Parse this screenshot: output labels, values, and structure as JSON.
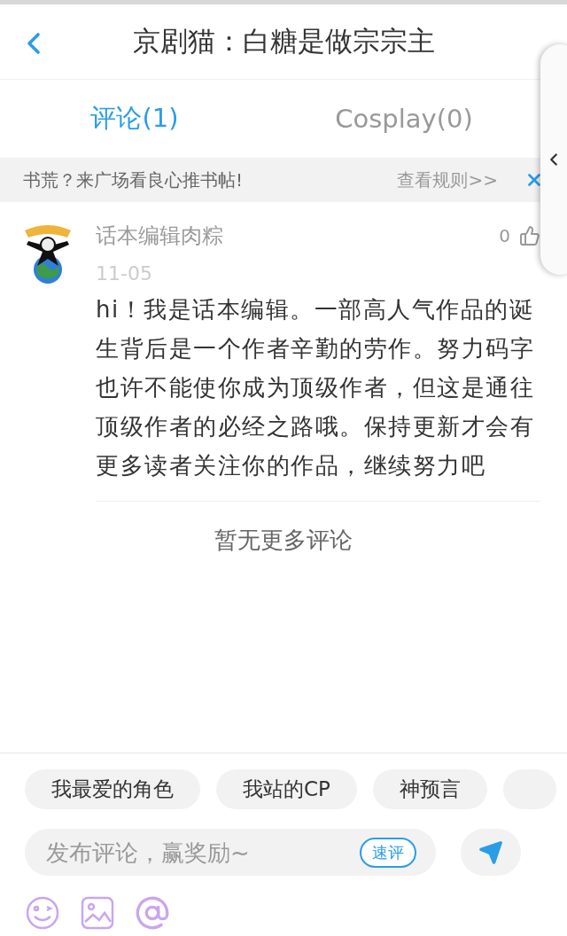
{
  "header": {
    "title": "京剧猫：白糖是做宗宗主"
  },
  "tabs": [
    {
      "label": "评论(1)",
      "selected": true
    },
    {
      "label": "Cosplay(0)",
      "selected": false
    }
  ],
  "banner": {
    "text": "书荒？来广场看良心推书帖!",
    "link": "查看规则>>"
  },
  "comments": [
    {
      "author": "话本编辑肉粽",
      "date": "11-05",
      "likes": "0",
      "body": "hi！我是话本编辑。一部高人气作品的诞生背后是一个作者辛勤的劳作。努力码字也许不能使你成为顶级作者，但这是通往顶级作者的必经之路哦。保持更新才会有更多读者关注你的作品，继续努力吧"
    }
  ],
  "end_note": "暂无更多评论",
  "composer": {
    "chips": [
      "我最爱的角色",
      "我站的CP",
      "神预言"
    ],
    "placeholder": "发布评论，赢奖励~",
    "quick_button": "速评"
  }
}
